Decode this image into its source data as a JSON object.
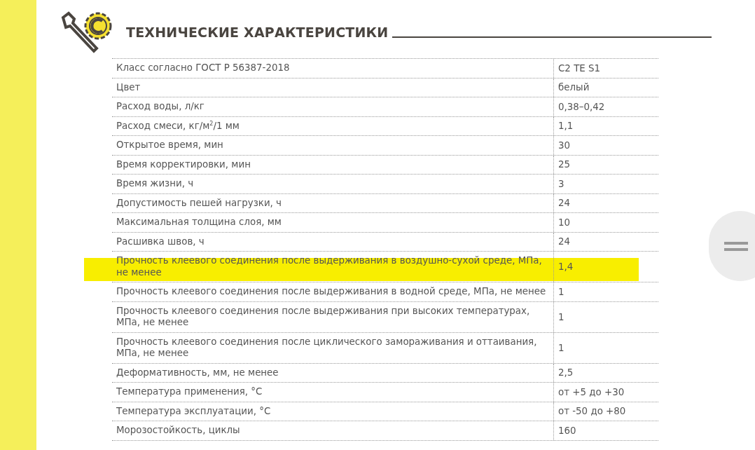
{
  "section": {
    "title": "ТЕХНИЧЕСКИЕ ХАРАКТЕРИСТИКИ"
  },
  "rows": [
    {
      "parameter": "Класс согласно ГОСТ Р  56387-2018",
      "value": "C2 TE S1",
      "highlighted": false
    },
    {
      "parameter": "Цвет",
      "value": "белый",
      "highlighted": false
    },
    {
      "parameter": "Расход воды, л/кг",
      "value": "0,38–0,42",
      "highlighted": false
    },
    {
      "parameter": "Расход смеси, кг/м$^{2}$/1 мм",
      "value": "1,1",
      "highlighted": false
    },
    {
      "parameter": "Открытое время, мин",
      "value": "30",
      "highlighted": false
    },
    {
      "parameter": "Время корректировки, мин",
      "value": "25",
      "highlighted": false
    },
    {
      "parameter": "Время жизни, ч",
      "value": "3",
      "highlighted": false
    },
    {
      "parameter": "Допустимость пешей нагрузки, ч",
      "value": "24",
      "highlighted": false
    },
    {
      "parameter": "Максимальная толщина слоя, мм",
      "value": "10",
      "highlighted": false
    },
    {
      "parameter": "Расшивка швов, ч",
      "value": "24",
      "highlighted": false
    },
    {
      "parameter": "Прочность клеевого соединения после выдерживания в воздушно-сухой среде, МПа, не менее",
      "value": "1,4",
      "highlighted": true
    },
    {
      "parameter": "Прочность клеевого соединения после выдерживания в водной среде, МПа, не менее",
      "value": "1",
      "highlighted": false
    },
    {
      "parameter": "Прочность клеевого соединения после выдерживания при высоких температурах, МПа, не менее",
      "value": "1",
      "highlighted": false
    },
    {
      "parameter": "Прочность клеевого соединения после циклического замораживания и оттаивания, МПа, не менее",
      "value": "1",
      "highlighted": false
    },
    {
      "parameter": "Деформативность, мм, не менее",
      "value": "2,5",
      "highlighted": false
    },
    {
      "parameter": "Температура применения, °С",
      "value": "от +5 до +30",
      "highlighted": false
    },
    {
      "parameter": "Температура эксплуатации, °С",
      "value": "от -50 до +80",
      "highlighted": false
    },
    {
      "parameter": "Морозостойкость, циклы",
      "value": "160",
      "highlighted": false
    }
  ]
}
